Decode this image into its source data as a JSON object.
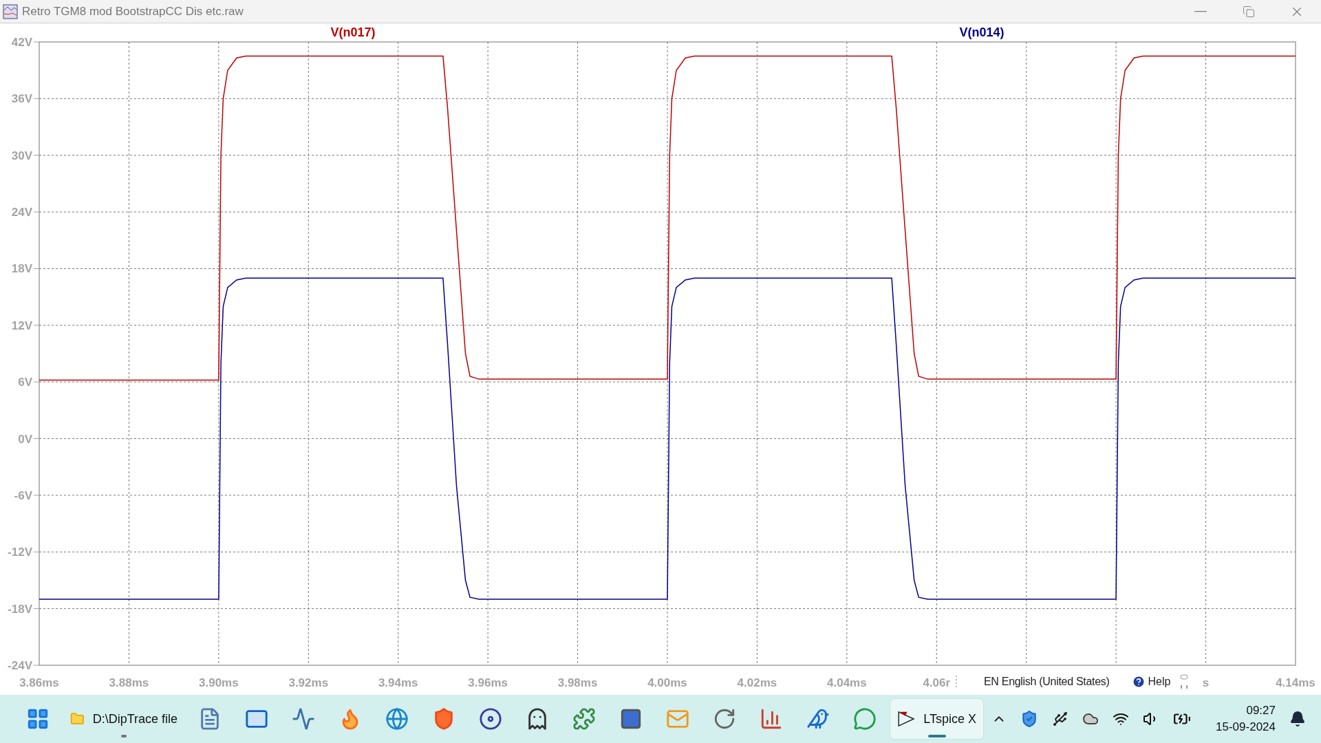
{
  "window": {
    "title": "Retro TGM8 mod BootstrapCC Dis etc.raw"
  },
  "plot": {
    "chart_data": {
      "type": "line",
      "grid": true,
      "xlim": [
        3.86,
        4.14
      ],
      "ylim": [
        -24,
        42
      ],
      "x": [
        3.86,
        3.9,
        3.9005,
        3.901,
        3.902,
        3.904,
        3.906,
        3.95,
        3.951,
        3.953,
        3.955,
        3.956,
        3.958,
        4.0,
        4.0005,
        4.001,
        4.002,
        4.004,
        4.006,
        4.05,
        4.051,
        4.053,
        4.055,
        4.056,
        4.058,
        4.1,
        4.1005,
        4.101,
        4.102,
        4.104,
        4.106,
        4.14
      ],
      "series": [
        {
          "name": "V(n017)",
          "color": "#c00000",
          "values": [
            6.2,
            6.2,
            30,
            36,
            39,
            40.3,
            40.5,
            40.5,
            35,
            22,
            9,
            6.6,
            6.3,
            6.3,
            30,
            36,
            39,
            40.3,
            40.5,
            40.5,
            35,
            22,
            9,
            6.6,
            6.3,
            6.3,
            30,
            36,
            39,
            40.3,
            40.5,
            40.5
          ]
        },
        {
          "name": "V(n014)",
          "color": "#000090",
          "values": [
            -17,
            -17,
            8,
            14,
            16,
            16.8,
            17,
            17,
            10,
            -5,
            -15,
            -16.8,
            -17,
            -17,
            8,
            14,
            16,
            16.8,
            17,
            17,
            10,
            -5,
            -15,
            -16.8,
            -17,
            -17,
            8,
            14,
            16,
            16.8,
            17,
            17
          ]
        }
      ],
      "xticks": [
        {
          "value": 3.86,
          "label": "3.86ms"
        },
        {
          "value": 3.88,
          "label": "3.88ms"
        },
        {
          "value": 3.9,
          "label": "3.90ms"
        },
        {
          "value": 3.92,
          "label": "3.92ms"
        },
        {
          "value": 3.94,
          "label": "3.94ms"
        },
        {
          "value": 3.96,
          "label": "3.96ms"
        },
        {
          "value": 3.98,
          "label": "3.98ms"
        },
        {
          "value": 4.0,
          "label": "4.00ms"
        },
        {
          "value": 4.02,
          "label": "4.02ms"
        },
        {
          "value": 4.04,
          "label": "4.04ms"
        },
        {
          "value": 4.06,
          "label": "4.06r"
        },
        {
          "value": 4.12,
          "label": "s"
        },
        {
          "value": 4.14,
          "label": "4.14ms"
        }
      ],
      "yticks": [
        {
          "value": 42,
          "label": "42V"
        },
        {
          "value": 36,
          "label": "36V"
        },
        {
          "value": 30,
          "label": "30V"
        },
        {
          "value": 24,
          "label": "24V"
        },
        {
          "value": 18,
          "label": "18V"
        },
        {
          "value": 12,
          "label": "12V"
        },
        {
          "value": 6,
          "label": "6V"
        },
        {
          "value": 0,
          "label": "0V"
        },
        {
          "value": -6,
          "label": "-6V"
        },
        {
          "value": -12,
          "label": "-12V"
        },
        {
          "value": -18,
          "label": "-18V"
        },
        {
          "value": -24,
          "label": "-24V"
        }
      ]
    }
  },
  "overlay": {
    "language": "EN English (United States)",
    "help": "Help"
  },
  "taskbar": {
    "items": [
      {
        "selected": false,
        "running": false
      },
      {
        "label": "D:\\DipTrace file",
        "selected": false,
        "running": true
      },
      {
        "selected": false,
        "running": false
      },
      {
        "selected": false,
        "running": false
      },
      {
        "selected": false,
        "running": false
      },
      {
        "selected": false,
        "running": false
      },
      {
        "selected": false,
        "running": false
      },
      {
        "selected": false,
        "running": false
      },
      {
        "selected": false,
        "running": false
      },
      {
        "selected": false,
        "running": false
      },
      {
        "selected": false,
        "running": false
      },
      {
        "selected": false,
        "running": false
      },
      {
        "selected": false,
        "running": false
      },
      {
        "selected": false,
        "running": false
      },
      {
        "selected": false,
        "running": false
      },
      {
        "selected": false,
        "running": false
      },
      {
        "selected": false,
        "running": false
      },
      {
        "label": "LTspice X",
        "selected": true,
        "running": true
      }
    ],
    "tray": {
      "time": "09:27",
      "date": "15-09-2024"
    }
  }
}
